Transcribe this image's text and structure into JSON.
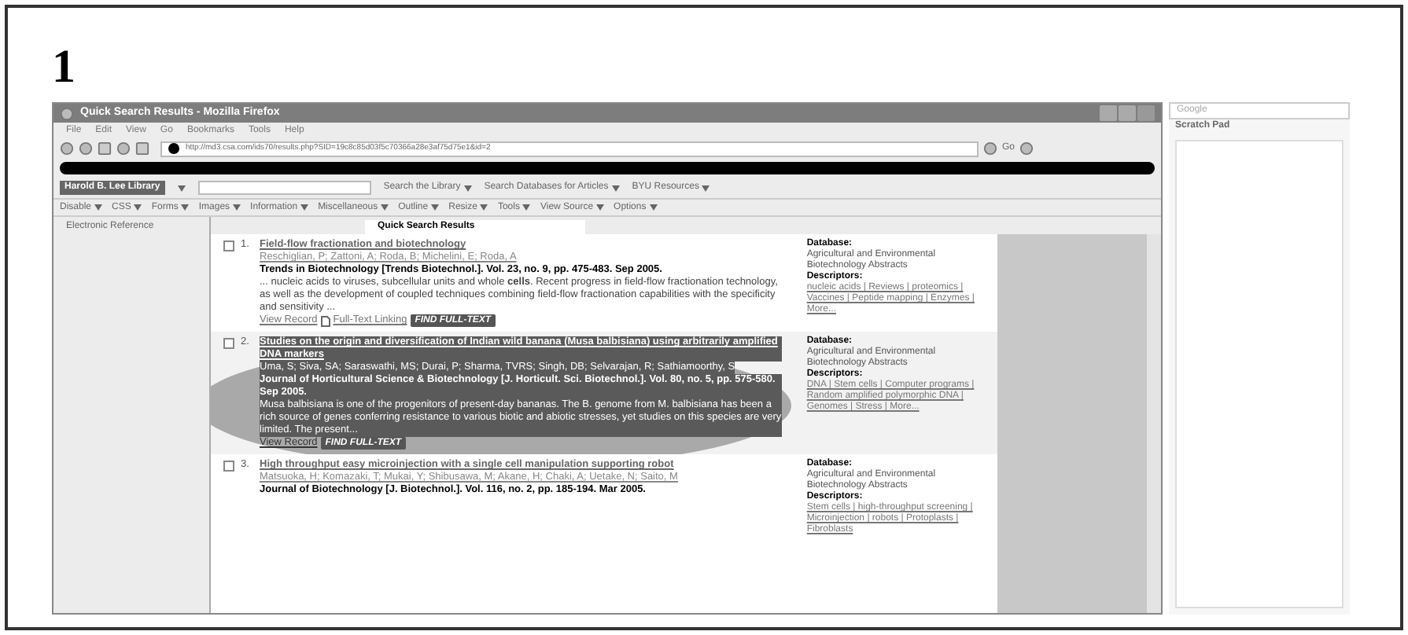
{
  "figure_label": "1",
  "window": {
    "title": "Quick Search Results - Mozilla Firefox"
  },
  "menu": [
    "File",
    "Edit",
    "View",
    "Go",
    "Bookmarks",
    "Tools",
    "Help"
  ],
  "address": {
    "value": "http://md3.csa.com/ids70/results.php?SID=19c8c85d03f5c70366a28e3af75d75e1&id=2",
    "go": "Go"
  },
  "library_toolbar": {
    "name": "Harold B. Lee Library",
    "items": [
      "Search the Library",
      "Search Databases for Articles",
      "BYU Resources"
    ]
  },
  "dev_toolbar": [
    "Disable",
    "CSS",
    "Forms",
    "Images",
    "Information",
    "Miscellaneous",
    "Outline",
    "Resize",
    "Tools",
    "View Source",
    "Options"
  ],
  "sidebar_left": {
    "title": "Electronic Reference"
  },
  "tabs": [
    {
      "label": "Quick Search Results",
      "selected": true
    }
  ],
  "results": [
    {
      "number": "1.",
      "checked": false,
      "highlighted": false,
      "title": "Field-flow fractionation and biotechnology",
      "authors": "Reschiglian, P; Zattoni, A; Roda, B; Michelini, E; Roda, A",
      "source": "Trends in Biotechnology [Trends Biotechnol.]. Vol. 23, no. 9, pp. 475-483. Sep 2005.",
      "abstract": "... nucleic acids to viruses, subcellular units and whole **cells**. Recent progress in field-flow fractionation technology, as well as the development of coupled techniques combining field-flow fractionation capabilities with the specificity and sensitivity ...",
      "links": [
        "View Record",
        "Full-Text Linking"
      ],
      "find": "FIND FULL-TEXT",
      "database_label": "Database:",
      "database": "Agricultural and Environmental Biotechnology Abstracts",
      "descriptors_label": "Descriptors:",
      "descriptors": "nucleic acids | Reviews | proteomics | Vaccines | Peptide mapping | Enzymes | More..."
    },
    {
      "number": "2.",
      "checked": false,
      "highlighted": true,
      "title": "Studies on the origin and diversification of Indian wild banana (Musa balbisiana) using arbitrarily amplified DNA markers",
      "authors": "Uma, S; Siva, SA; Saraswathi, MS; Durai, P; Sharma, TVRS; Singh, DB; Selvarajan, R; Sathiamoorthy, S",
      "source": "Journal of Horticultural Science & Biotechnology [J. Horticult. Sci. Biotechnol.]. Vol. 80, no. 5, pp. 575-580. Sep 2005.",
      "abstract": "Musa balbisiana is one of the progenitors of present-day bananas. The B. genome from M. balbisiana has been a rich source of genes conferring resistance to various biotic and abiotic stresses, yet studies on this species are very limited. The present...",
      "links": [
        "View Record"
      ],
      "find": "FIND FULL-TEXT",
      "database_label": "Database:",
      "database": "Agricultural and Environmental Biotechnology Abstracts",
      "descriptors_label": "Descriptors:",
      "descriptors": "DNA | Stem cells | Computer programs | Random amplified polymorphic DNA | Genomes | Stress | More..."
    },
    {
      "number": "3.",
      "checked": false,
      "highlighted": false,
      "title": "High throughput easy microinjection with a single cell manipulation supporting robot",
      "authors": "Matsuoka, H; Komazaki, T; Mukai, Y; Shibusawa, M; Akane, H; Chaki, A; Uetake, N; Saito, M",
      "source": "Journal of Biotechnology [J. Biotechnol.]. Vol. 116, no. 2, pp. 185-194. Mar 2005.",
      "database_label": "Database:",
      "database": "Agricultural and Environmental Biotechnology Abstracts",
      "descriptors_label": "Descriptors:",
      "descriptors": "Stem cells | high-throughput screening | Microinjection | robots | Protoplasts | Fibroblasts"
    }
  ],
  "google_bar": {
    "placeholder": "Google"
  },
  "scratch_pad": {
    "title": "Scratch Pad"
  }
}
